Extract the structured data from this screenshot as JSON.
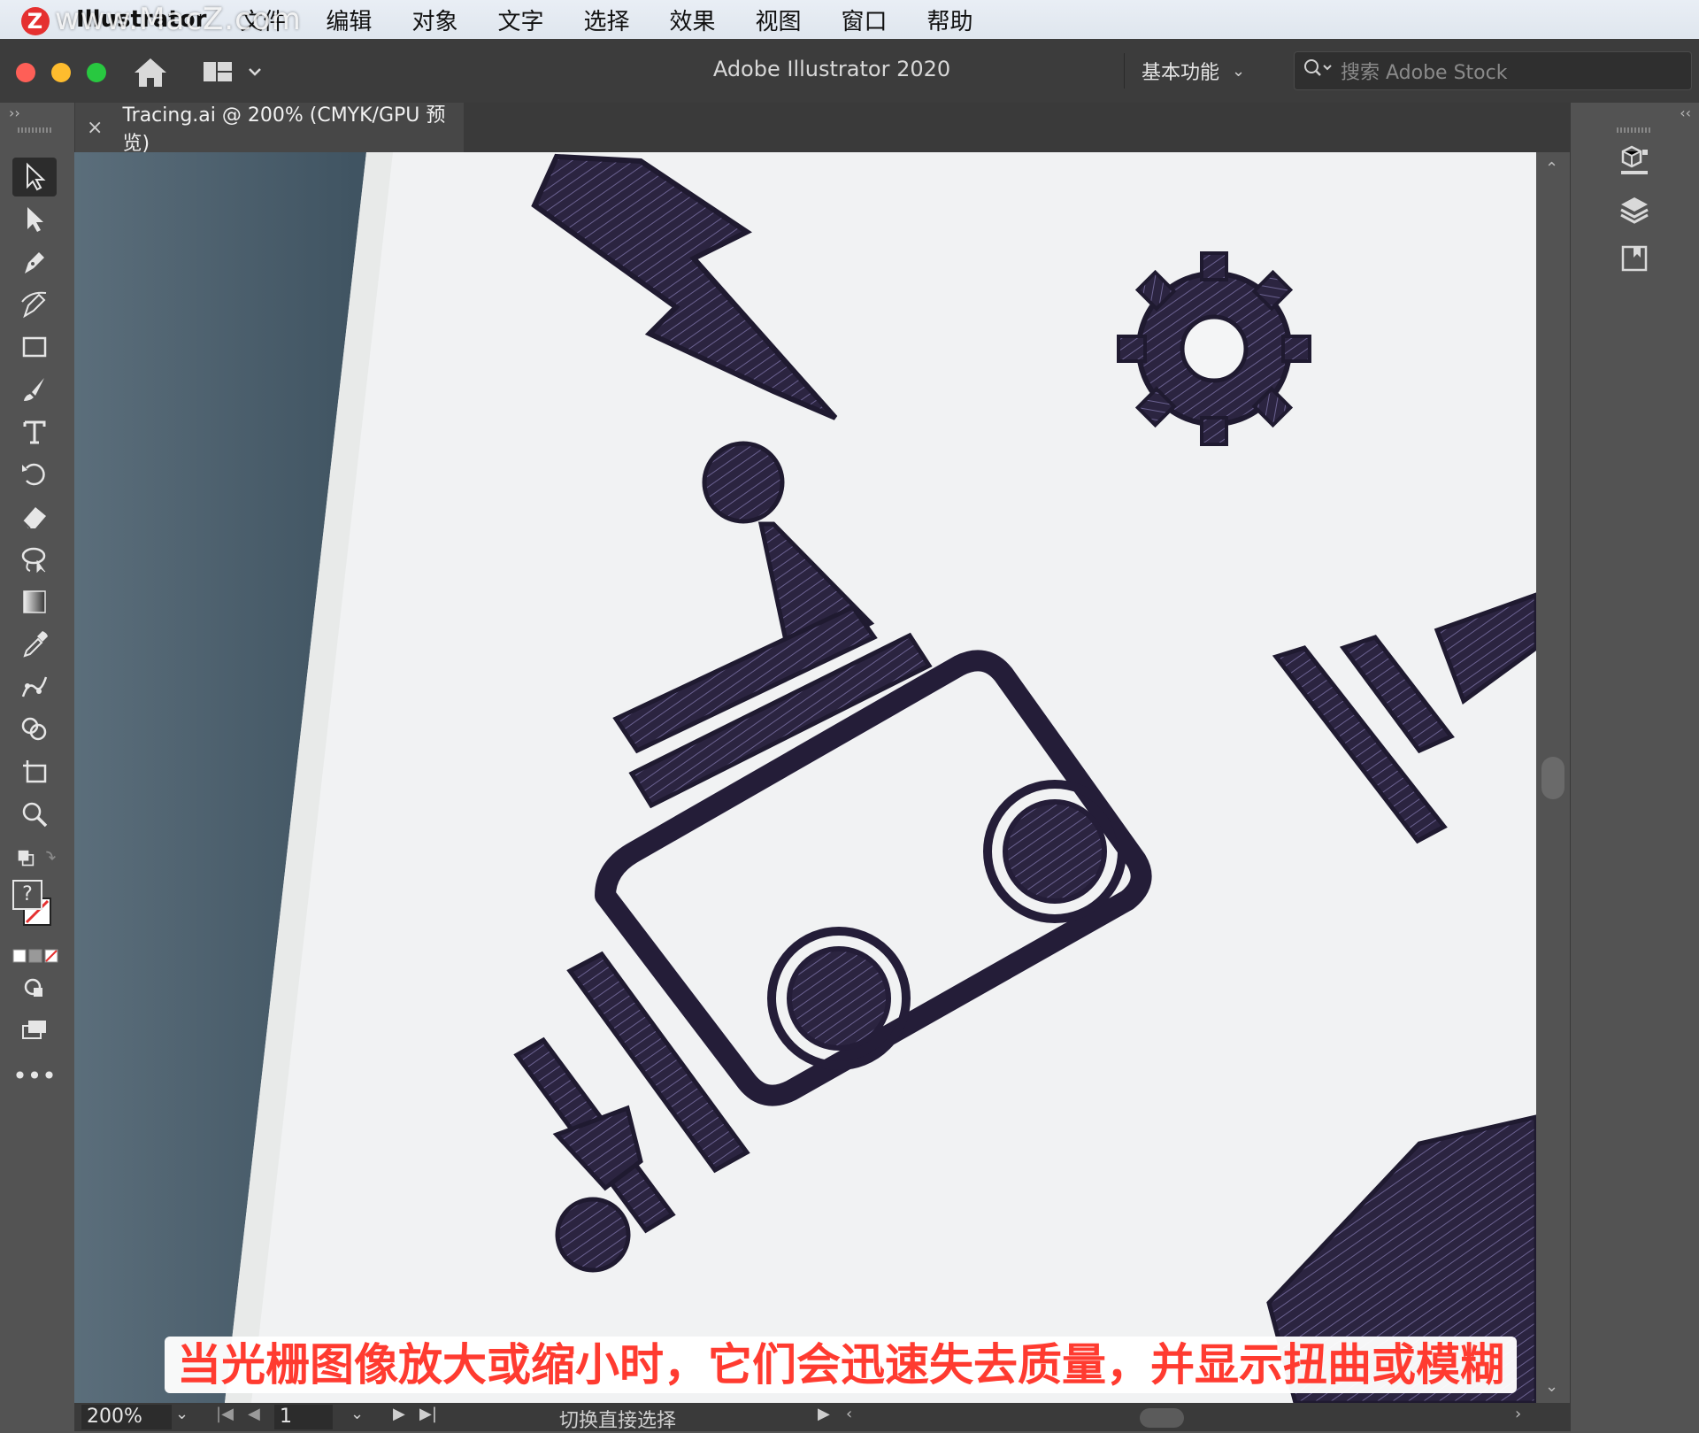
{
  "menubar": {
    "app_name": "Illustrator",
    "items": [
      "文件",
      "编辑",
      "对象",
      "文字",
      "选择",
      "效果",
      "视图",
      "窗口",
      "帮助"
    ]
  },
  "watermark": {
    "badge": "Z",
    "text": "www.MacZ.com"
  },
  "titlebar": {
    "title": "Adobe Illustrator 2020",
    "workspace": "基本功能",
    "stock_search_placeholder": "搜索 Adobe Stock"
  },
  "document_tab": {
    "close": "×",
    "label": "Tracing.ai @ 200% (CMYK/GPU 预览)"
  },
  "tools": [
    "selection-tool",
    "direct-selection-tool",
    "pen-tool",
    "curvature-tool",
    "rectangle-tool",
    "paintbrush-tool",
    "type-tool",
    "rotate-tool",
    "eraser-tool",
    "lasso-tool",
    "gradient-tool",
    "eyedropper-tool",
    "puppet-warp-tool",
    "shape-builder-tool",
    "artboard-tool",
    "zoom-tool"
  ],
  "fill_stroke": {
    "fill_unknown": "?"
  },
  "right_panels": [
    "libraries-panel",
    "layers-panel",
    "export-panel"
  ],
  "statusbar": {
    "zoom": "200%",
    "page": "1",
    "status_text": "切换直接选择"
  },
  "subtitle": "当光栅图像放大或缩小时，它们会迅速失去质量，并显示扭曲或模糊",
  "colors": {
    "ink": "#2b2440",
    "paper": "#f4f5f6",
    "desk": "#4f6270",
    "subtitle_red": "#ff3b30",
    "ui_dark": "#3c3c3c",
    "ui_mid": "#535353"
  }
}
